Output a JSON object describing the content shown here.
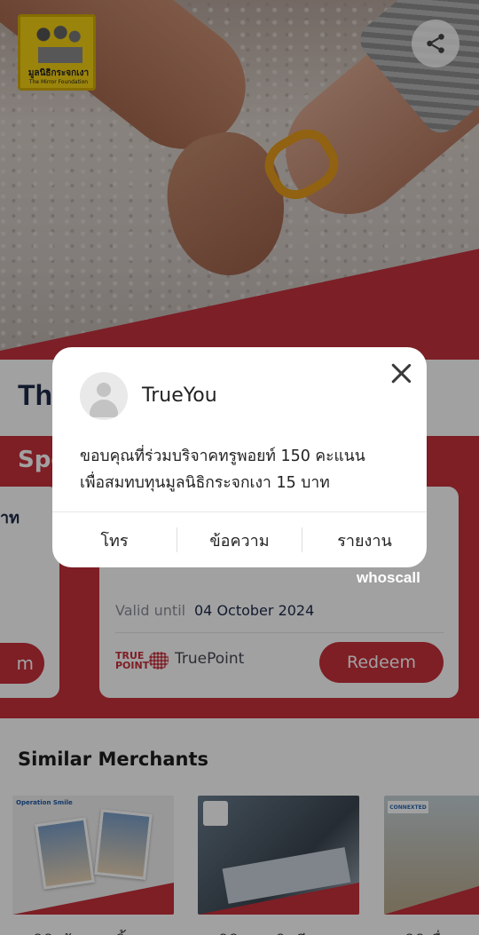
{
  "hero": {
    "logo_text_th": "มูลนิธิกระจกเงา",
    "logo_text_en": "The Mirror Foundation",
    "share_icon": "share-icon"
  },
  "page_title": "Th",
  "special": {
    "label": "Spe",
    "left_card_fragment": "าท",
    "left_card_button": "m",
    "card": {
      "valid_label": "Valid until",
      "valid_date": "04 October 2024",
      "partner_logo_line1": "TRUE",
      "partner_logo_line2": "POINT",
      "partner_name": "TruePoint",
      "redeem_label": "Redeem"
    }
  },
  "watermark": "whoscall",
  "similar": {
    "heading": "Similar Merchants",
    "items": [
      {
        "brand": "Operation Smile",
        "caption": "มูลนิธิสร้างรอยยิ้ม"
      },
      {
        "brand": "",
        "caption": "มูลนิธิรามาธิบดีฯ"
      },
      {
        "brand": "CONNEXTED",
        "caption": "มูลนิธิเพื่อ"
      }
    ]
  },
  "dialog": {
    "sender": "TrueYou",
    "message_line1": "ขอบคุณที่ร่วมบริจาคทรูพอยท์ 150 คะแนน",
    "message_line2": "เพื่อสมทบทุนมูลนิธิกระจกเงา 15 บาท",
    "actions": [
      "โทร",
      "ข้อความ",
      "รายงาน"
    ]
  },
  "colors": {
    "accent_red": "#c8303c",
    "title_navy": "#1d2a4a",
    "overlay": "rgba(0,0,0,0.37)"
  }
}
